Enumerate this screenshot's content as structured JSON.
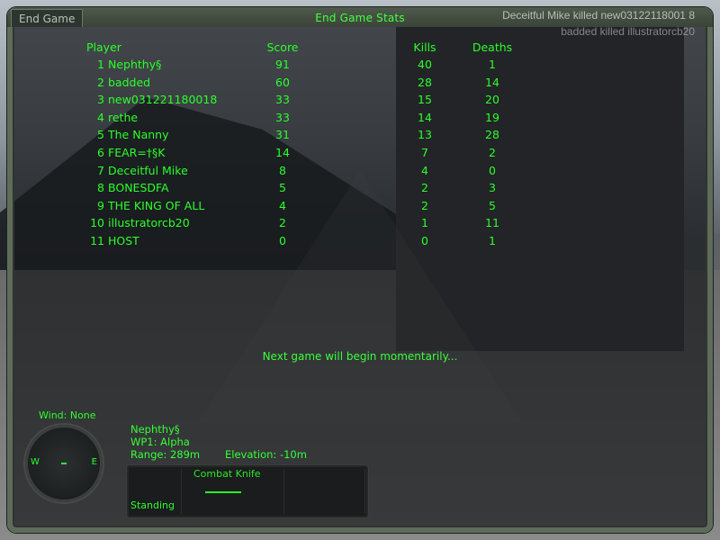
{
  "window": {
    "tab_label": "End Game",
    "title": "End Game Stats"
  },
  "killfeed": [
    {
      "text": "Deceitful Mike killed new03122118001 8"
    },
    {
      "text": "badded killed illustratorcb20"
    }
  ],
  "scoreboard": {
    "headers": {
      "player": "Player",
      "score": "Score",
      "kills": "Kills",
      "deaths": "Deaths"
    },
    "rows": [
      {
        "rank": "1",
        "player": "Nephthy§",
        "score": "91",
        "kills": "40",
        "deaths": "1"
      },
      {
        "rank": "2",
        "player": "badded",
        "score": "60",
        "kills": "28",
        "deaths": "14"
      },
      {
        "rank": "3",
        "player": "new031221180018",
        "score": "33",
        "kills": "15",
        "deaths": "20"
      },
      {
        "rank": "4",
        "player": "rethe",
        "score": "33",
        "kills": "14",
        "deaths": "19"
      },
      {
        "rank": "5",
        "player": "The Nanny",
        "score": "31",
        "kills": "13",
        "deaths": "28"
      },
      {
        "rank": "6",
        "player": "FEAR=†§K",
        "score": "14",
        "kills": "7",
        "deaths": "2"
      },
      {
        "rank": "7",
        "player": "Deceitful Mike",
        "score": "8",
        "kills": "4",
        "deaths": "0"
      },
      {
        "rank": "8",
        "player": "BONESDFA",
        "score": "5",
        "kills": "2",
        "deaths": "3"
      },
      {
        "rank": "9",
        "player": "THE KING OF ALL",
        "score": "4",
        "kills": "2",
        "deaths": "5"
      },
      {
        "rank": "10",
        "player": "illustratorcb20",
        "score": "2",
        "kills": "1",
        "deaths": "11"
      },
      {
        "rank": "11",
        "player": "HOST",
        "score": "0",
        "kills": "0",
        "deaths": "1"
      }
    ]
  },
  "message": "Next game will begin momentarily...",
  "hud": {
    "wind": "Wind: None",
    "compass": {
      "west": "W",
      "east": "E"
    },
    "player": "Nephthy§",
    "waypoint": "WP1: Alpha",
    "range": "Range: 289m",
    "elevation": "Elevation: -10m",
    "weapon": "Combat Knife",
    "stance": "Standing"
  }
}
